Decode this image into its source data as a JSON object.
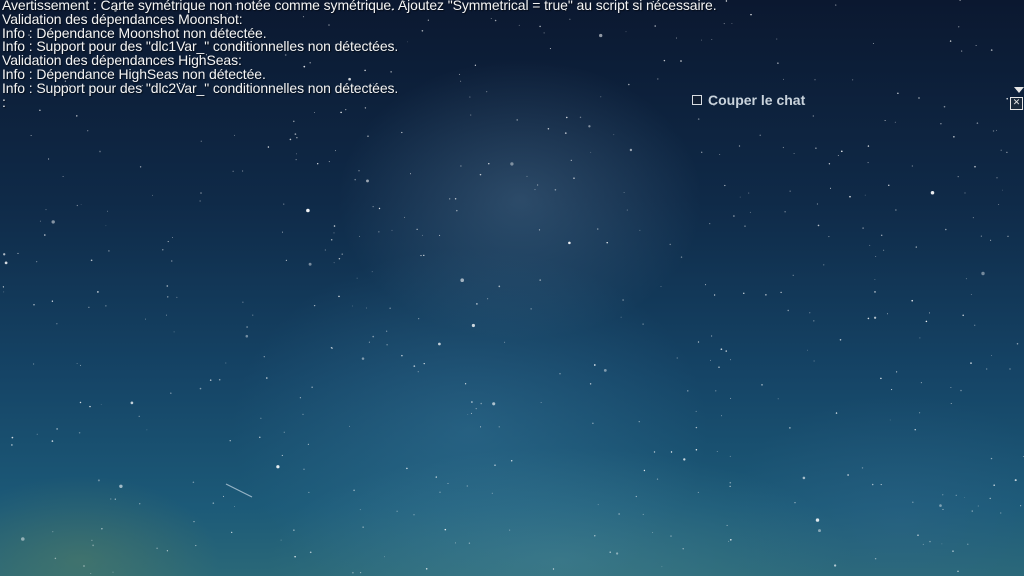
{
  "console": {
    "lines": [
      "Avertissement : Carte symétrique non notée comme symétrique. Ajoutez \"Symmetrical = true\" au script si nécessaire.",
      "Validation des dépendances Moonshot:",
      "Info : Dépendance Moonshot non détectée.",
      "Info : Support pour des \"dlc1Var_\" conditionnelles non détectées.",
      "Validation des dépendances HighSeas:",
      "Info : Dépendance HighSeas non détectée.",
      "Info : Support pour des \"dlc2Var_\" conditionnelles non détectées.",
      ":"
    ]
  },
  "chat": {
    "mute_label": "Couper le chat",
    "mute_checked": false
  },
  "icons": {
    "scroll": "scroll-down-arrow-icon",
    "close": "close-icon"
  },
  "colors": {
    "text": "#f4f4f4",
    "mute_text": "#c9d3dc",
    "sky_top": "#0b1830",
    "sky_bottom": "#2a6878"
  }
}
